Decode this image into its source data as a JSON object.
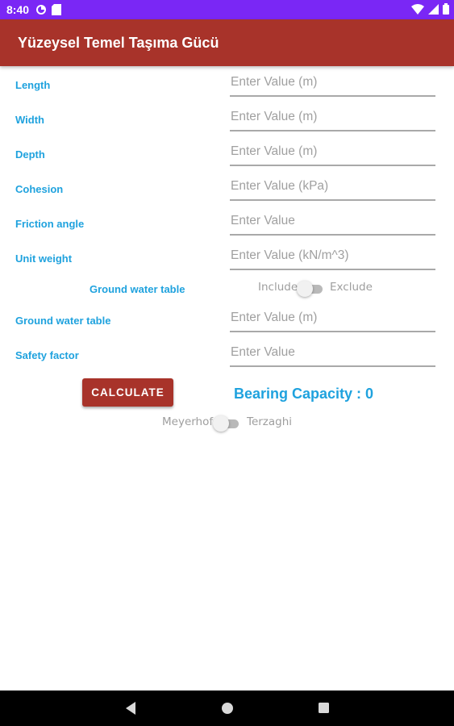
{
  "status_bar": {
    "time": "8:40",
    "icons_left": [
      "settings-gear-icon",
      "sd-card-icon"
    ],
    "icons_right": [
      "wifi-icon",
      "signal-icon",
      "battery-icon"
    ],
    "color": "#7a27f5"
  },
  "app_bar": {
    "title": "Yüzeysel Temel Taşıma Gücü",
    "color": "#a8332a"
  },
  "form": {
    "fields": [
      {
        "label": "Length",
        "placeholder": "Enter Value (m)",
        "value": ""
      },
      {
        "label": "Width",
        "placeholder": "Enter Value (m)",
        "value": ""
      },
      {
        "label": "Depth",
        "placeholder": "Enter Value (m)",
        "value": ""
      },
      {
        "label": "Cohesion",
        "placeholder": "Enter Value (kPa)",
        "value": ""
      },
      {
        "label": "Friction angle",
        "placeholder": "Enter Value",
        "value": ""
      },
      {
        "label": "Unit weight",
        "placeholder": "Enter Value (kN/m^3)",
        "value": ""
      },
      {
        "label": "Ground water table",
        "placeholder": "Enter Value (m)",
        "value": ""
      },
      {
        "label": "Safety factor",
        "placeholder": "Enter Value",
        "value": ""
      }
    ],
    "groundwater_switch": {
      "label": "Ground water table",
      "left_text": "Include",
      "right_text": "Exclude",
      "checked": false
    },
    "method_switch": {
      "left_text": "Meyerhof",
      "right_text": "Terzaghi",
      "checked": false
    }
  },
  "actions": {
    "calculate_label": "CALCULATE",
    "result_text": "Bearing Capacity : 0"
  },
  "colors": {
    "accent_text": "#1fa2de",
    "primary": "#a8332a"
  },
  "nav_bar": {
    "buttons": [
      "back-icon",
      "home-icon",
      "recents-icon"
    ]
  }
}
